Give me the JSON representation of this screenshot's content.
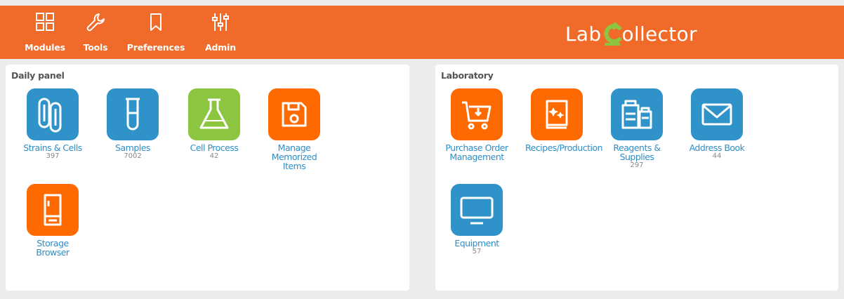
{
  "nav": {
    "items": [
      {
        "label": "Modules",
        "icon": "modules-icon"
      },
      {
        "label": "Tools",
        "icon": "wrench-icon"
      },
      {
        "label": "Preferences",
        "icon": "bookmark-icon"
      },
      {
        "label": "Admin",
        "icon": "sliders-icon"
      }
    ]
  },
  "logo": {
    "part1": "Lab",
    "part2": "ollector"
  },
  "daily_panel": {
    "title": "Daily panel",
    "tiles": [
      {
        "label": "Strains & Cells",
        "count": "397",
        "icon": "paperclips-icon",
        "color": "#2f93c9"
      },
      {
        "label": "Samples",
        "count": "7002",
        "icon": "test-tube-icon",
        "color": "#2f93c9"
      },
      {
        "label": "Cell Process",
        "count": "42",
        "icon": "flask-icon",
        "color": "#8cc540"
      },
      {
        "label": "Manage Memorized Items",
        "count": "",
        "icon": "floppy-disk-icon",
        "color": "#ff6a00"
      },
      {
        "label": "Storage Browser",
        "count": "",
        "icon": "freezer-icon",
        "color": "#ff6a00"
      }
    ]
  },
  "laboratory": {
    "title": "Laboratory",
    "tiles": [
      {
        "label": "Purchase Order Management",
        "count": "",
        "icon": "shopping-cart-icon",
        "color": "#ff6a00"
      },
      {
        "label": "Recipes/Production",
        "count": "",
        "icon": "recipe-book-icon",
        "color": "#ff6a00"
      },
      {
        "label": "Reagents & Supplies",
        "count": "297",
        "icon": "bottles-icon",
        "color": "#2f93c9"
      },
      {
        "label": "Address Book",
        "count": "44",
        "icon": "envelope-icon",
        "color": "#2f93c9"
      },
      {
        "label": "Equipment",
        "count": "57",
        "icon": "monitor-icon",
        "color": "#2f93c9"
      }
    ]
  }
}
